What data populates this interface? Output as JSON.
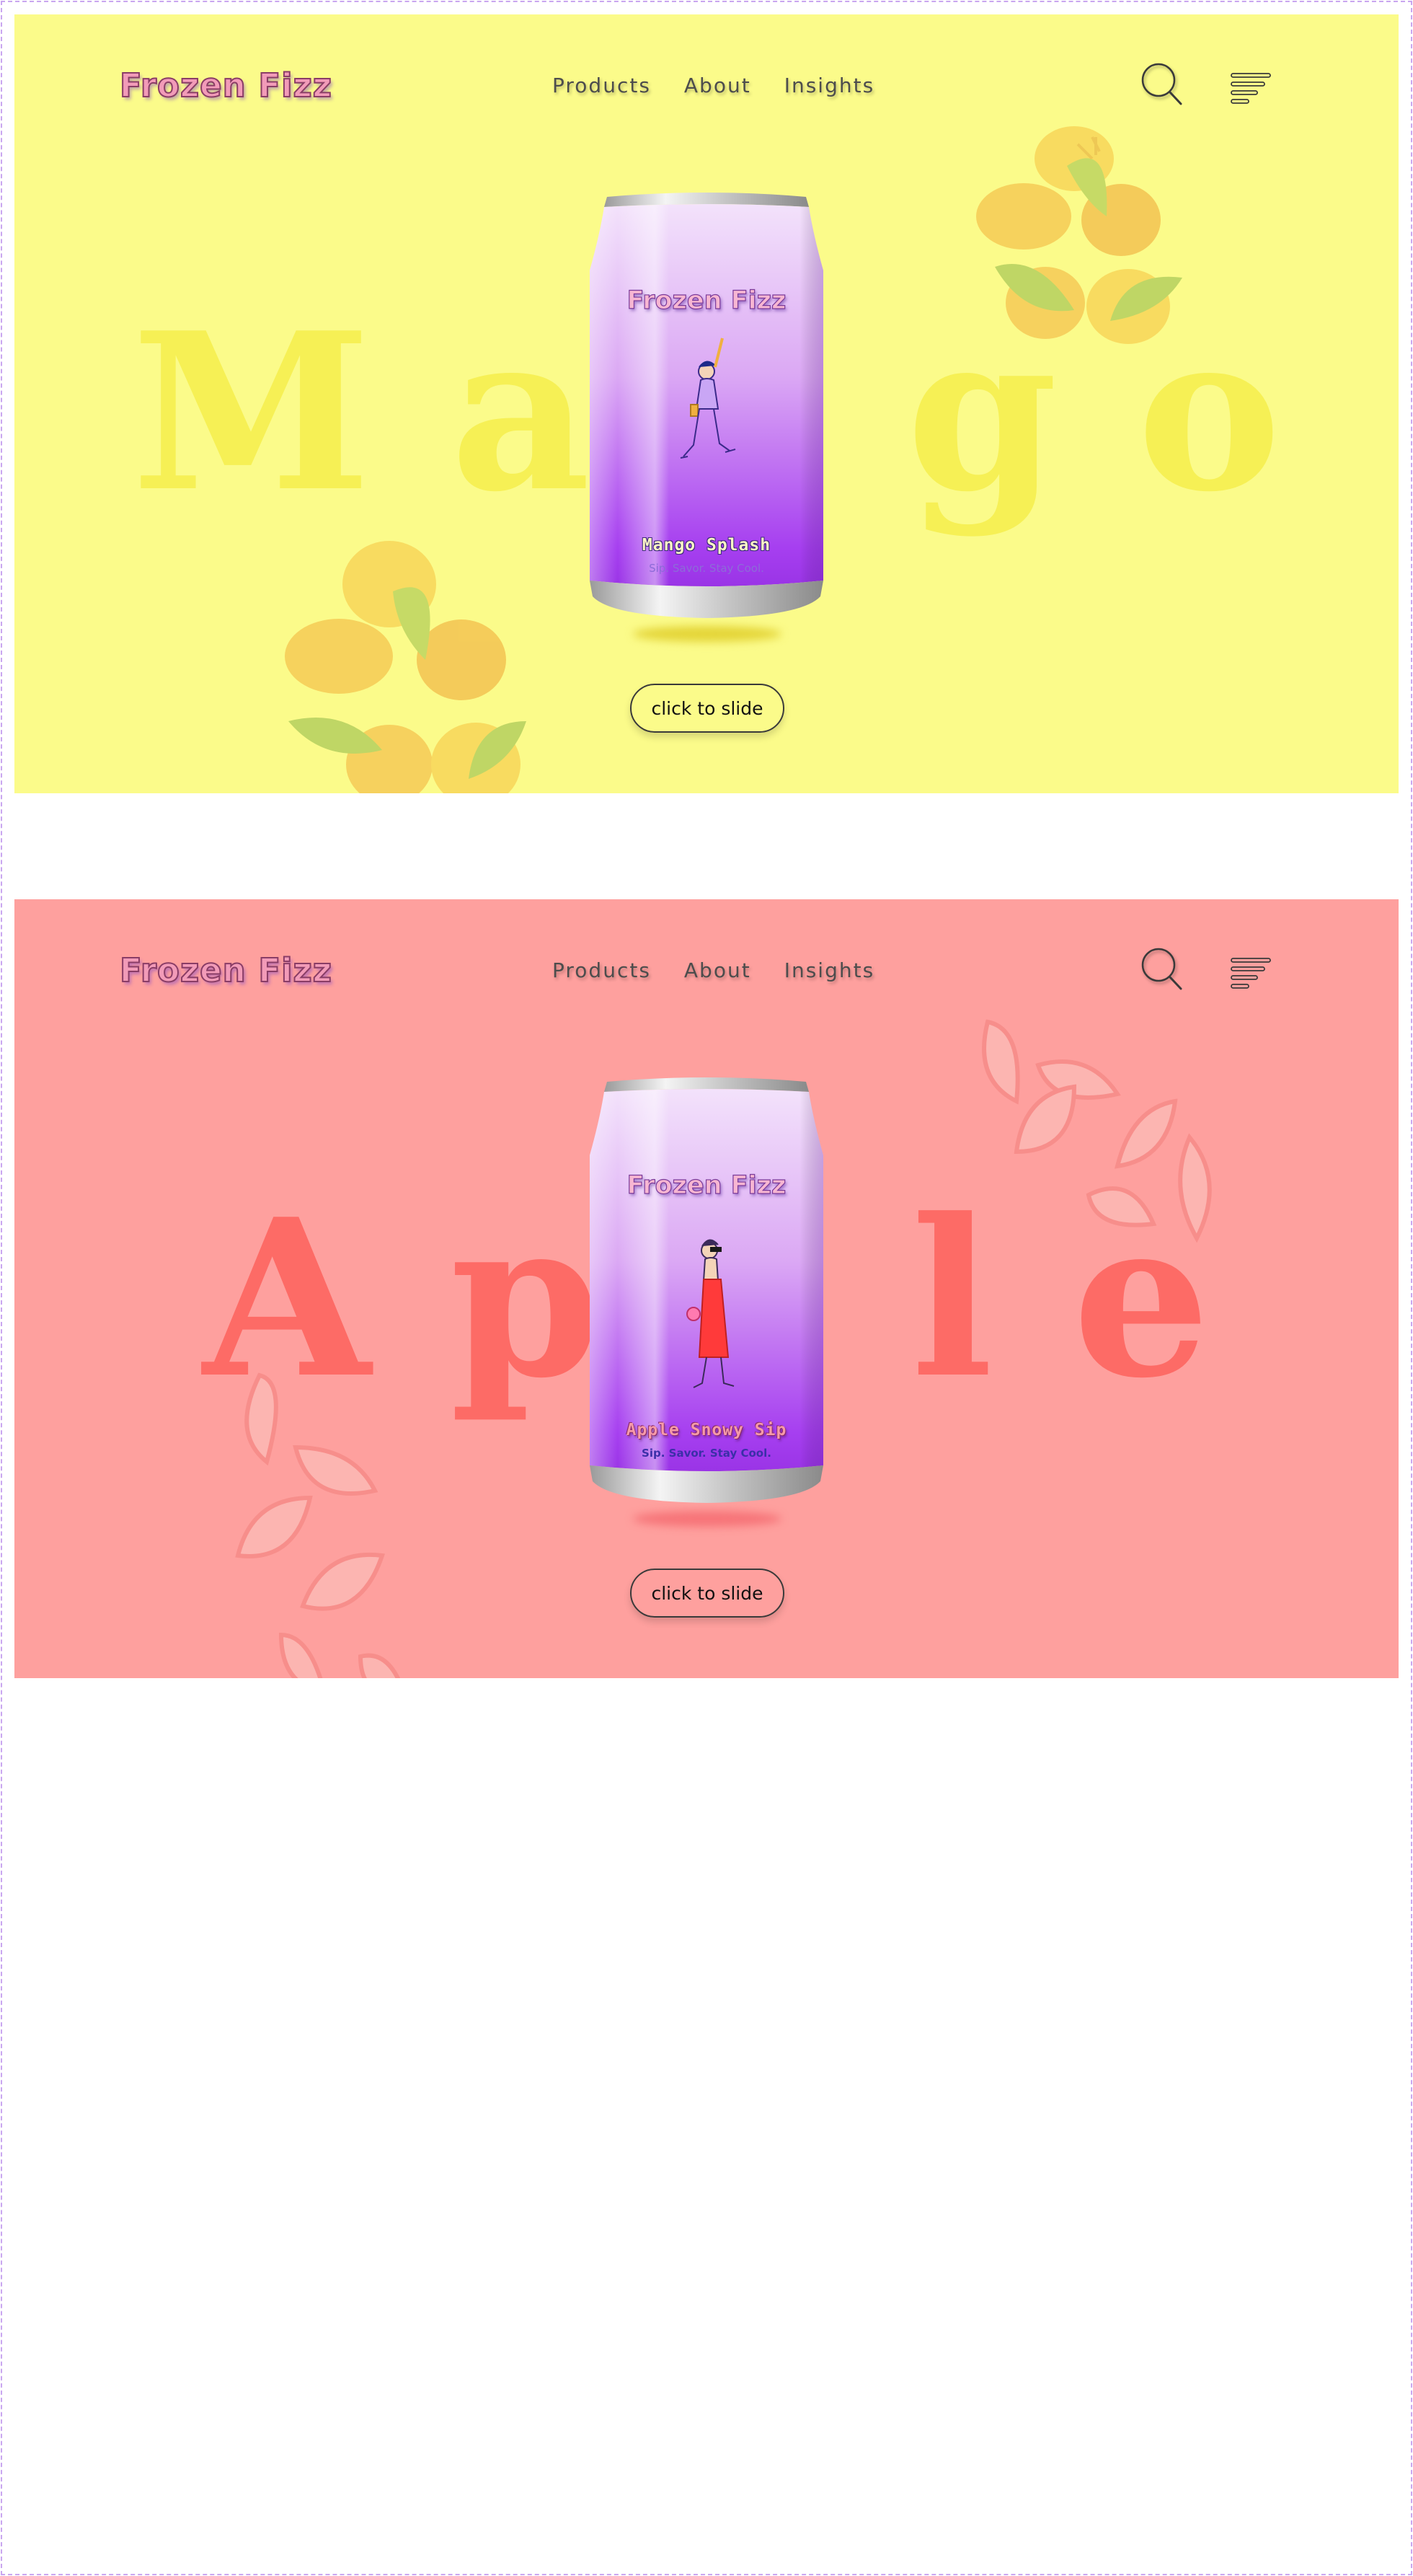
{
  "slides": [
    {
      "id": "mango",
      "background_color": "#fbfb8a",
      "brand": "Frozen Fizz",
      "nav": [
        "Products",
        "About",
        "Insights"
      ],
      "icons": {
        "search": "search-icon",
        "menu": "hamburger-menu-icon"
      },
      "background_word": "Mango",
      "can": {
        "brand": "Frozen Fizz",
        "flavor": "Mango Splash",
        "tagline": "Sip. Savor. Stay Cool."
      },
      "button_label": "click to slide"
    },
    {
      "id": "apple",
      "background_color": "#fea09e",
      "brand": "Frozen Fizz",
      "nav": [
        "Products",
        "About",
        "Insights"
      ],
      "icons": {
        "search": "search-icon",
        "menu": "hamburger-menu-icon"
      },
      "background_word": "Apple",
      "can": {
        "brand": "Frozen Fizz",
        "flavor": "Apple Snowy Sip",
        "tagline": "Sip. Savor. Stay Cool."
      },
      "button_label": "click to slide"
    }
  ]
}
